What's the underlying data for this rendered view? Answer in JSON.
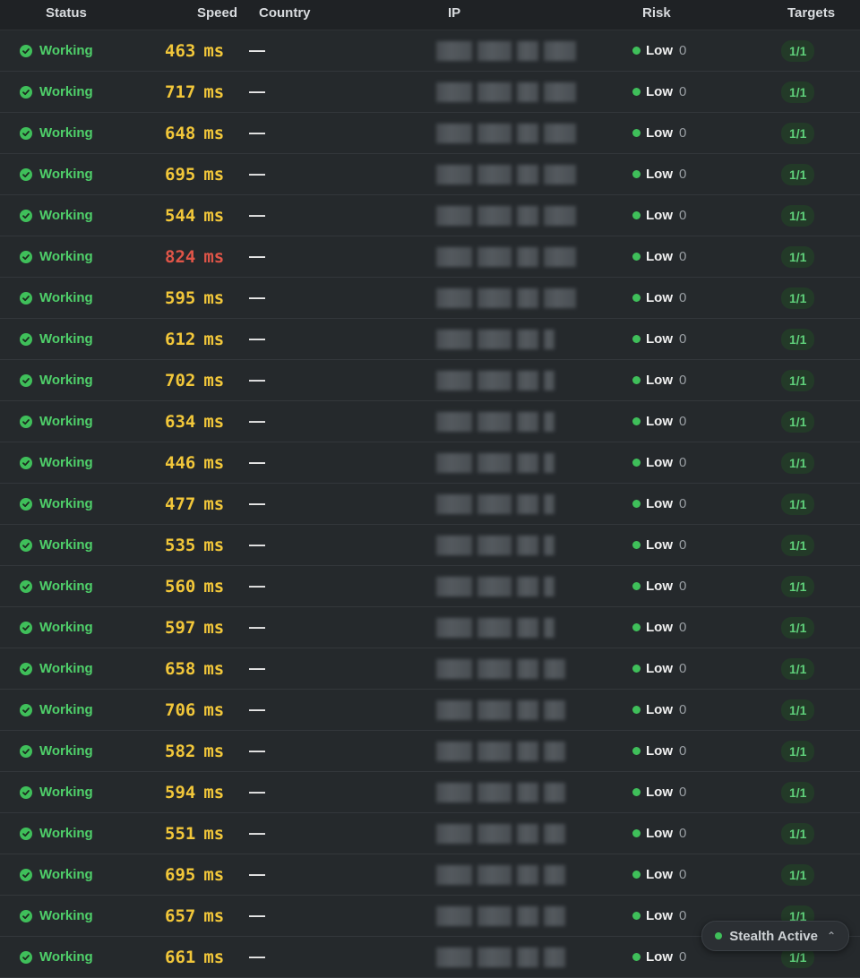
{
  "header": {
    "status": "Status",
    "speed": "Speed",
    "country": "Country",
    "ip": "IP",
    "risk": "Risk",
    "targets": "Targets"
  },
  "rows": [
    {
      "status": "Working",
      "speed": "463",
      "unit": "ms",
      "slow": false,
      "country": "—",
      "risk": "Low",
      "score": "0",
      "targets": "1/1"
    },
    {
      "status": "Working",
      "speed": "717",
      "unit": "ms",
      "slow": false,
      "country": "—",
      "risk": "Low",
      "score": "0",
      "targets": "1/1"
    },
    {
      "status": "Working",
      "speed": "648",
      "unit": "ms",
      "slow": false,
      "country": "—",
      "risk": "Low",
      "score": "0",
      "targets": "1/1"
    },
    {
      "status": "Working",
      "speed": "695",
      "unit": "ms",
      "slow": false,
      "country": "—",
      "risk": "Low",
      "score": "0",
      "targets": "1/1"
    },
    {
      "status": "Working",
      "speed": "544",
      "unit": "ms",
      "slow": false,
      "country": "—",
      "risk": "Low",
      "score": "0",
      "targets": "1/1"
    },
    {
      "status": "Working",
      "speed": "824",
      "unit": "ms",
      "slow": true,
      "country": "—",
      "risk": "Low",
      "score": "0",
      "targets": "1/1"
    },
    {
      "status": "Working",
      "speed": "595",
      "unit": "ms",
      "slow": false,
      "country": "—",
      "risk": "Low",
      "score": "0",
      "targets": "1/1"
    },
    {
      "status": "Working",
      "speed": "612",
      "unit": "ms",
      "slow": false,
      "country": "—",
      "risk": "Low",
      "score": "0",
      "targets": "1/1"
    },
    {
      "status": "Working",
      "speed": "702",
      "unit": "ms",
      "slow": false,
      "country": "—",
      "risk": "Low",
      "score": "0",
      "targets": "1/1"
    },
    {
      "status": "Working",
      "speed": "634",
      "unit": "ms",
      "slow": false,
      "country": "—",
      "risk": "Low",
      "score": "0",
      "targets": "1/1"
    },
    {
      "status": "Working",
      "speed": "446",
      "unit": "ms",
      "slow": false,
      "country": "—",
      "risk": "Low",
      "score": "0",
      "targets": "1/1"
    },
    {
      "status": "Working",
      "speed": "477",
      "unit": "ms",
      "slow": false,
      "country": "—",
      "risk": "Low",
      "score": "0",
      "targets": "1/1"
    },
    {
      "status": "Working",
      "speed": "535",
      "unit": "ms",
      "slow": false,
      "country": "—",
      "risk": "Low",
      "score": "0",
      "targets": "1/1"
    },
    {
      "status": "Working",
      "speed": "560",
      "unit": "ms",
      "slow": false,
      "country": "—",
      "risk": "Low",
      "score": "0",
      "targets": "1/1"
    },
    {
      "status": "Working",
      "speed": "597",
      "unit": "ms",
      "slow": false,
      "country": "—",
      "risk": "Low",
      "score": "0",
      "targets": "1/1"
    },
    {
      "status": "Working",
      "speed": "658",
      "unit": "ms",
      "slow": false,
      "country": "—",
      "risk": "Low",
      "score": "0",
      "targets": "1/1"
    },
    {
      "status": "Working",
      "speed": "706",
      "unit": "ms",
      "slow": false,
      "country": "—",
      "risk": "Low",
      "score": "0",
      "targets": "1/1"
    },
    {
      "status": "Working",
      "speed": "582",
      "unit": "ms",
      "slow": false,
      "country": "—",
      "risk": "Low",
      "score": "0",
      "targets": "1/1"
    },
    {
      "status": "Working",
      "speed": "594",
      "unit": "ms",
      "slow": false,
      "country": "—",
      "risk": "Low",
      "score": "0",
      "targets": "1/1"
    },
    {
      "status": "Working",
      "speed": "551",
      "unit": "ms",
      "slow": false,
      "country": "—",
      "risk": "Low",
      "score": "0",
      "targets": "1/1"
    },
    {
      "status": "Working",
      "speed": "695",
      "unit": "ms",
      "slow": false,
      "country": "—",
      "risk": "Low",
      "score": "0",
      "targets": "1/1"
    },
    {
      "status": "Working",
      "speed": "657",
      "unit": "ms",
      "slow": false,
      "country": "—",
      "risk": "Low",
      "score": "0",
      "targets": "1/1"
    },
    {
      "status": "Working",
      "speed": "661",
      "unit": "ms",
      "slow": false,
      "country": "—",
      "risk": "Low",
      "score": "0",
      "targets": "1/1"
    }
  ],
  "stealth": {
    "label": "Stealth Active"
  },
  "colors": {
    "ok": "#4fd06a",
    "speed": "#f2c73a",
    "slow": "#e05548",
    "background": "#202326"
  }
}
